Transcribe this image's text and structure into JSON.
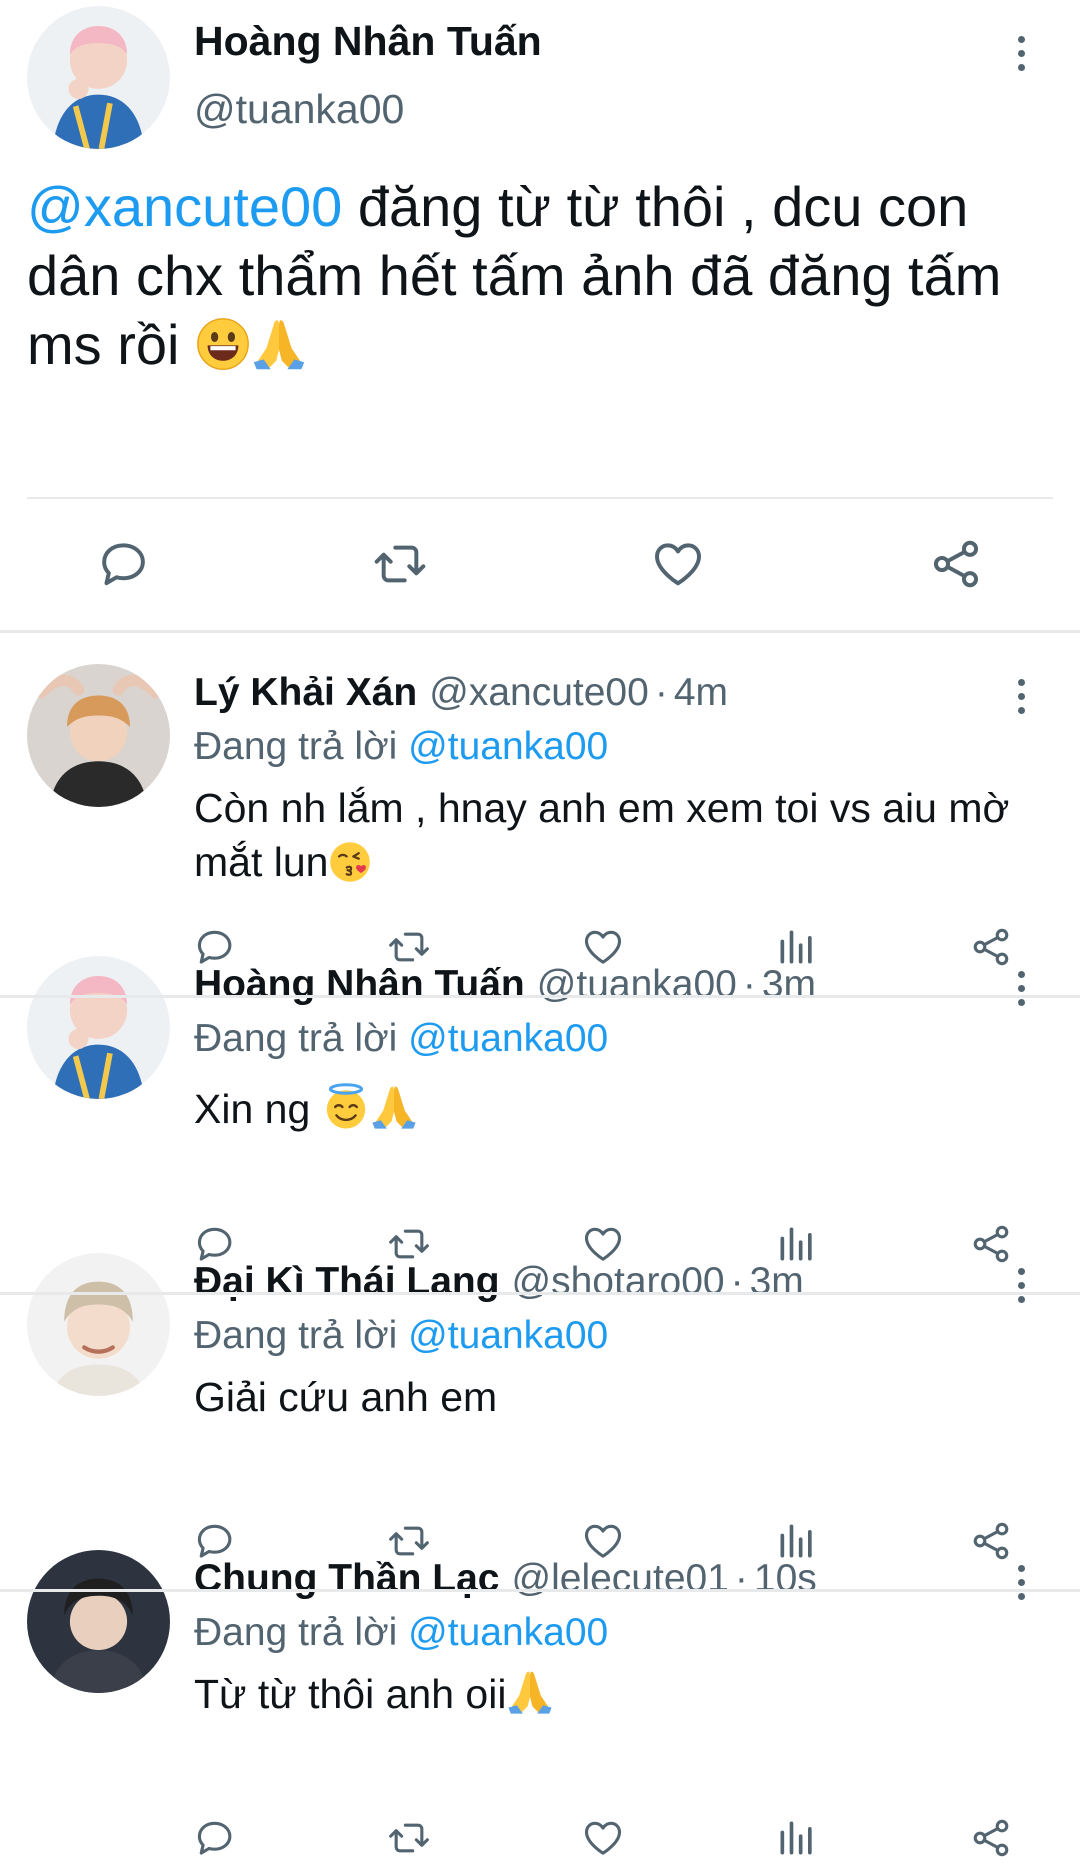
{
  "colors": {
    "accent": "#1d9bf0",
    "text": "#0f1419",
    "secondary": "#536471",
    "divider": "#e7e9ea"
  },
  "main_tweet": {
    "name": "Hoàng Nhân Tuấn",
    "handle": "@tuanka00",
    "text_mention": "@xancute00",
    "text_body": " đăng từ từ thôi , dcu con dân chx thẩm hết tấm ảnh đã đăng tấm ms rồi ",
    "emojis": [
      "grinning-face-emoji",
      "folded-hands-emoji"
    ],
    "actions": [
      "reply-icon",
      "retweet-icon",
      "like-icon",
      "share-icon"
    ]
  },
  "replies": [
    {
      "name": "Lý Khải Xán",
      "handle": "@xancute00",
      "dot": "·",
      "time": "4m",
      "replying_label": "Đang trả lời ",
      "replying_to": "@tuanka00",
      "text": "Còn nh lắm , hnay anh em xem toi vs aiu mờ mắt lun",
      "emojis": [
        "kissing-face-emoji"
      ]
    },
    {
      "name": "Hoàng Nhân Tuấn",
      "handle": "@tuanka00",
      "dot": "·",
      "time": "3m",
      "replying_label": "Đang trả lời ",
      "replying_to": "@tuanka00",
      "text": "Xin ng ",
      "emojis": [
        "halo-face-emoji",
        "folded-hands-emoji"
      ]
    },
    {
      "name": "Đại Kì Thái Lang",
      "handle": "@shotaro00",
      "dot": "·",
      "time": "3m",
      "replying_label": "Đang trả lời ",
      "replying_to": "@tuanka00",
      "text": "Giải cứu anh em",
      "emojis": []
    },
    {
      "name": "Chung Thần Lạc",
      "handle": "@lelecute01",
      "dot": "·",
      "time": "10s",
      "replying_label": "Đang trả lời ",
      "replying_to": "@tuanka00",
      "text": "Từ từ thôi anh oii",
      "emojis": [
        "folded-hands-emoji"
      ]
    }
  ]
}
